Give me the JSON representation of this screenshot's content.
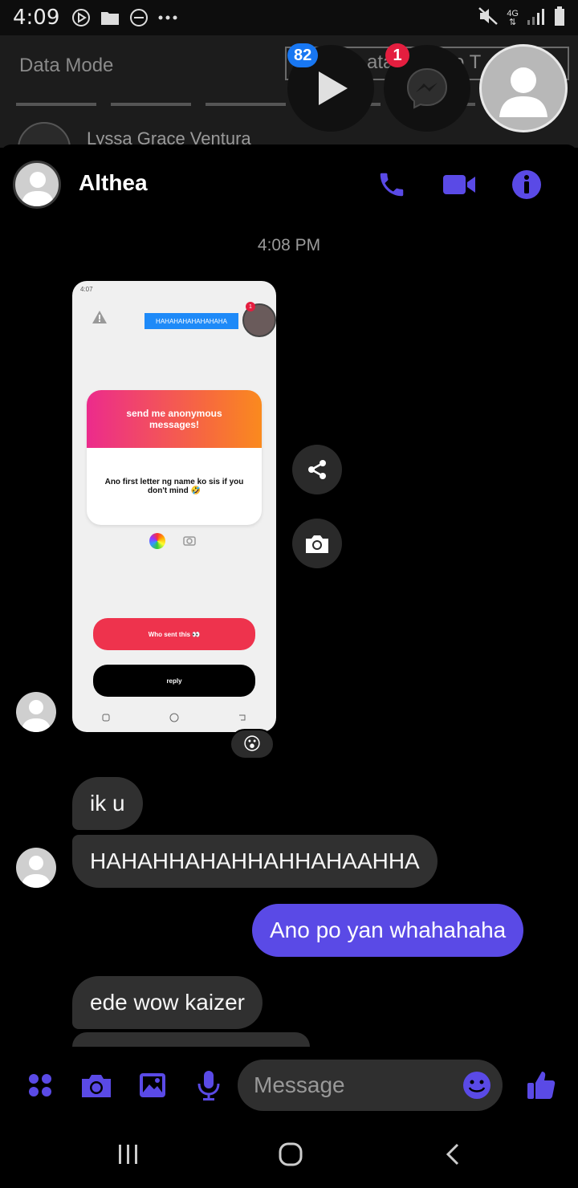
{
  "status_bar": {
    "time": "4:09",
    "network": "4G",
    "icons": [
      "play-circle-icon",
      "folder-icon",
      "dnd-icon",
      "more-icon",
      "mute-icon",
      "network-icon",
      "signal-icon",
      "battery-icon"
    ]
  },
  "background_app": {
    "data_mode": "Data Mode",
    "box_text_fragments": [
      "ata",
      "o T"
    ],
    "contact_name": "Lyssa Grace Ventura"
  },
  "chat_heads": {
    "play_badge": "82",
    "messenger_badge": "1"
  },
  "conversation": {
    "contact_name": "Althea",
    "timestamp": "4:08 PM",
    "accent_color": "#5a4ae6",
    "image_message": {
      "status_time": "4:07",
      "sent_bubble": "HAHAHAHAHAHAHAHA",
      "avatar_badge": "1",
      "card_title": "send me anonymous messages!",
      "card_message": "Ano first letter ng name ko sis if you don't mind 🤣",
      "who_sent_button": "Who sent this 👀",
      "reply_button": "reply",
      "reaction": "😮"
    },
    "messages": [
      {
        "direction": "incoming",
        "text": "ik u"
      },
      {
        "direction": "incoming",
        "text": "HAHAHHAHAHHAHHAHAAHHA"
      },
      {
        "direction": "outgoing",
        "text": "Ano po yan whahahaha"
      },
      {
        "direction": "incoming",
        "text": "ede wow kaizer"
      }
    ]
  },
  "composer": {
    "placeholder": "Message"
  }
}
